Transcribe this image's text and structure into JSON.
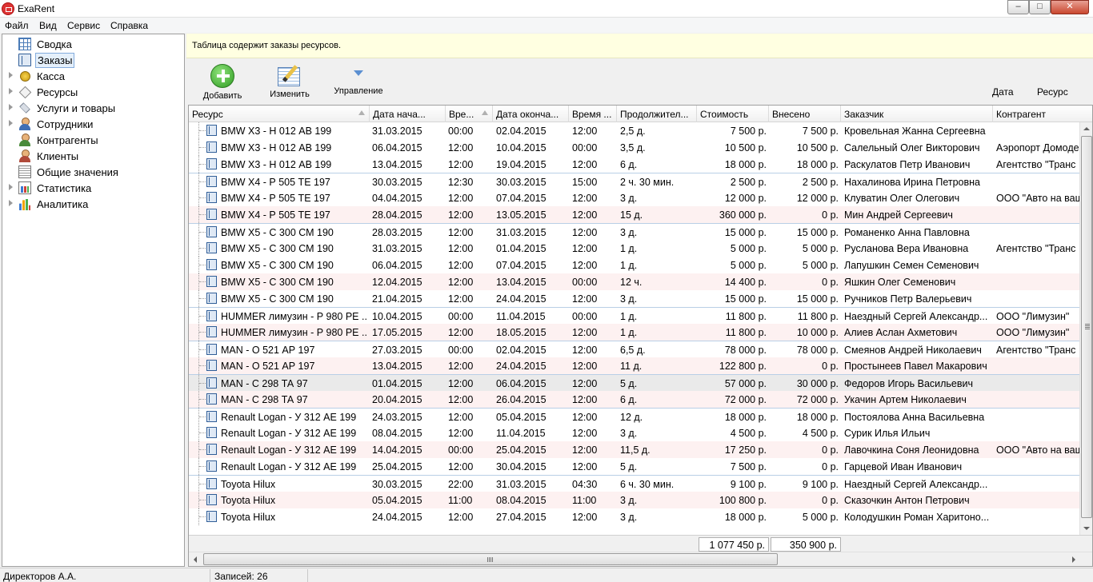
{
  "window": {
    "title": "ExaRent",
    "minimize": "0",
    "maximize": "1",
    "close": "r"
  },
  "menu": [
    "Файл",
    "Вид",
    "Сервис",
    "Справка"
  ],
  "tree": [
    {
      "label": "Сводка",
      "icon": "calendar-grid-icon",
      "expandable": false
    },
    {
      "label": "Заказы",
      "icon": "book-icon",
      "expandable": false,
      "selected": true
    },
    {
      "label": "Касса",
      "icon": "coins-icon",
      "expandable": true
    },
    {
      "label": "Ресурсы",
      "icon": "tag-icon",
      "expandable": true
    },
    {
      "label": "Услуги и товары",
      "icon": "diamond-icon",
      "expandable": true
    },
    {
      "label": "Сотрудники",
      "icon": "person-icon",
      "expandable": true
    },
    {
      "label": "Контрагенты",
      "icon": "person-icon",
      "expandable": false
    },
    {
      "label": "Клиенты",
      "icon": "person-icon",
      "expandable": false
    },
    {
      "label": "Общие значения",
      "icon": "list-icon",
      "expandable": false
    },
    {
      "label": "Статистика",
      "icon": "statistics-icon",
      "expandable": true
    },
    {
      "label": "Аналитика",
      "icon": "bar-chart-icon",
      "expandable": true
    }
  ],
  "info": "Таблица содержит заказы ресурсов.",
  "toolbar": {
    "add": "Добавить",
    "edit": "Изменить",
    "manage": "Управление"
  },
  "view_links": {
    "date": "Дата",
    "resource": "Ресурс"
  },
  "columns": [
    "Ресурс",
    "Дата нача...",
    "Вре...",
    "Дата оконча...",
    "Время ...",
    "Продолжител...",
    "Стоимость",
    "Внесено",
    "Заказчик",
    "Контрагент"
  ],
  "rows": [
    [
      "BMW X3 - Н 012 АВ 199",
      "31.03.2015",
      "00:00",
      "02.04.2015",
      "12:00",
      "2,5 д.",
      "7 500 р.",
      "7 500 р.",
      "Кровельная Жанна Сергеевна",
      ""
    ],
    [
      "BMW X3 - Н 012 АВ 199",
      "06.04.2015",
      "12:00",
      "10.04.2015",
      "00:00",
      "3,5 д.",
      "10 500 р.",
      "10 500 р.",
      "Салельный Олег Викторович",
      "Аэропорт Домоде"
    ],
    [
      "BMW X3 - Н 012 АВ 199",
      "13.04.2015",
      "12:00",
      "19.04.2015",
      "12:00",
      "6 д.",
      "18 000 р.",
      "18 000 р.",
      "Раскулатов Петр Иванович",
      "Агентство \"Транс"
    ],
    [
      "BMW X4 - Р 505 ТЕ 197",
      "30.03.2015",
      "12:30",
      "30.03.2015",
      "15:00",
      "2 ч. 30 мин.",
      "2 500 р.",
      "2 500 р.",
      "Нахалинова Ирина Петровна",
      ""
    ],
    [
      "BMW X4 - Р 505 ТЕ 197",
      "04.04.2015",
      "12:00",
      "07.04.2015",
      "12:00",
      "3 д.",
      "12 000 р.",
      "12 000 р.",
      "Клуватин Олег Олегович",
      "ООО \"Авто на ваш"
    ],
    [
      "BMW X4 - Р 505 ТЕ 197",
      "28.04.2015",
      "12:00",
      "13.05.2015",
      "12:00",
      "15 д.",
      "360 000 р.",
      "0 р.",
      "Мин Андрей Сергеевич",
      ""
    ],
    [
      "BMW X5 - С 300 СМ 190",
      "28.03.2015",
      "12:00",
      "31.03.2015",
      "12:00",
      "3 д.",
      "15 000 р.",
      "15 000 р.",
      "Романенко Анна Павловна",
      ""
    ],
    [
      "BMW X5 - С 300 СМ 190",
      "31.03.2015",
      "12:00",
      "01.04.2015",
      "12:00",
      "1 д.",
      "5 000 р.",
      "5 000 р.",
      "Русланова Вера Ивановна",
      "Агентство \"Транс"
    ],
    [
      "BMW X5 - С 300 СМ 190",
      "06.04.2015",
      "12:00",
      "07.04.2015",
      "12:00",
      "1 д.",
      "5 000 р.",
      "5 000 р.",
      "Лапушкин Семен Семенович",
      ""
    ],
    [
      "BMW X5 - С 300 СМ 190",
      "12.04.2015",
      "12:00",
      "13.04.2015",
      "00:00",
      "12 ч.",
      "14 400 р.",
      "0 р.",
      "Яшкин Олег Семенович",
      ""
    ],
    [
      "BMW X5 - С 300 СМ 190",
      "21.04.2015",
      "12:00",
      "24.04.2015",
      "12:00",
      "3 д.",
      "15 000 р.",
      "15 000 р.",
      "Ручников Петр Валерьевич",
      ""
    ],
    [
      "HUMMER лимузин - Р 980 РЕ ...",
      "10.04.2015",
      "00:00",
      "11.04.2015",
      "00:00",
      "1 д.",
      "11 800 р.",
      "11 800 р.",
      "Наездный Сергей Александр...",
      "ООО \"Лимузин\""
    ],
    [
      "HUMMER лимузин - Р 980 РЕ ...",
      "17.05.2015",
      "12:00",
      "18.05.2015",
      "12:00",
      "1 д.",
      "11 800 р.",
      "10 000 р.",
      "Алиев Аслан Ахметович",
      "ООО \"Лимузин\""
    ],
    [
      "MAN - О 521 АР 197",
      "27.03.2015",
      "00:00",
      "02.04.2015",
      "12:00",
      "6,5 д.",
      "78 000 р.",
      "78 000 р.",
      "Смеянов Андрей Николаевич",
      "Агентство \"Транс"
    ],
    [
      "MAN - О 521 АР 197",
      "13.04.2015",
      "12:00",
      "24.04.2015",
      "12:00",
      "11 д.",
      "122 800 р.",
      "0 р.",
      "Простынеев Павел Макарович",
      ""
    ],
    [
      "MAN - С 298 ТА 97",
      "01.04.2015",
      "12:00",
      "06.04.2015",
      "12:00",
      "5 д.",
      "57 000 р.",
      "30 000 р.",
      "Федоров Игорь Васильевич",
      ""
    ],
    [
      "MAN - С 298 ТА 97",
      "20.04.2015",
      "12:00",
      "26.04.2015",
      "12:00",
      "6 д.",
      "72 000 р.",
      "72 000 р.",
      "Укачин Артем Николаевич",
      ""
    ],
    [
      "Renault Logan - У 312 АЕ 199",
      "24.03.2015",
      "12:00",
      "05.04.2015",
      "12:00",
      "12 д.",
      "18 000 р.",
      "18 000 р.",
      "Постоялова Анна Васильевна",
      ""
    ],
    [
      "Renault Logan - У 312 АЕ 199",
      "08.04.2015",
      "12:00",
      "11.04.2015",
      "12:00",
      "3 д.",
      "4 500 р.",
      "4 500 р.",
      "Сурик Илья Ильич",
      ""
    ],
    [
      "Renault Logan - У 312 АЕ 199",
      "14.04.2015",
      "00:00",
      "25.04.2015",
      "12:00",
      "11,5 д.",
      "17 250 р.",
      "0 р.",
      "Лавочкина Соня Леонидовна",
      "ООО \"Авто на ваш"
    ],
    [
      "Renault Logan - У 312 АЕ 199",
      "25.04.2015",
      "12:00",
      "30.04.2015",
      "12:00",
      "5 д.",
      "7 500 р.",
      "0 р.",
      "Гарцевой Иван Иванович",
      ""
    ],
    [
      "Toyota Hilux",
      "30.03.2015",
      "22:00",
      "31.03.2015",
      "04:30",
      "6 ч. 30 мин.",
      "9 100 р.",
      "9 100 р.",
      "Наездный Сергей Александр...",
      ""
    ],
    [
      "Toyota Hilux",
      "05.04.2015",
      "11:00",
      "08.04.2015",
      "11:00",
      "3 д.",
      "100 800 р.",
      "0 р.",
      "Сказочкин Антон Петрович",
      ""
    ],
    [
      "Toyota Hilux",
      "24.04.2015",
      "12:00",
      "27.04.2015",
      "12:00",
      "3 д.",
      "18 000 р.",
      "5 000 р.",
      "Колодушкин Роман Харитоно...",
      ""
    ]
  ],
  "totals": {
    "cost": "1 077 450 р.",
    "paid": "350 900 р."
  },
  "status": {
    "user": "Директоров А.А.",
    "records": "Записей: 26"
  }
}
